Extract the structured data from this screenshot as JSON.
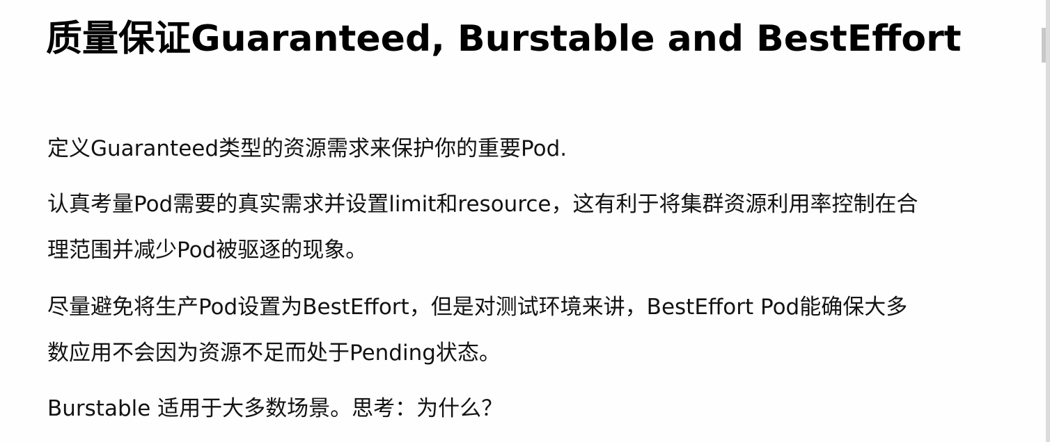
{
  "slide": {
    "title": "质量保证Guaranteed, Burstable and BestEffort",
    "paragraphs": {
      "p1": "定义Guaranteed类型的资源需求来保护你的重要Pod.",
      "p2_line1": "认真考量Pod需要的真实需求并设置limit和resource，这有利于将集群资源利用率控制在合",
      "p2_line2": "理范围并减少Pod被驱逐的现象。",
      "p3_line1": "尽量避免将生产Pod设置为BestEffort，但是对测试环境来讲，BestEffort Pod能确保大多",
      "p3_line2": "数应用不会因为资源不足而处于Pending状态。",
      "p4": "Burstable 适用于大多数场景。思考：为什么？"
    }
  }
}
